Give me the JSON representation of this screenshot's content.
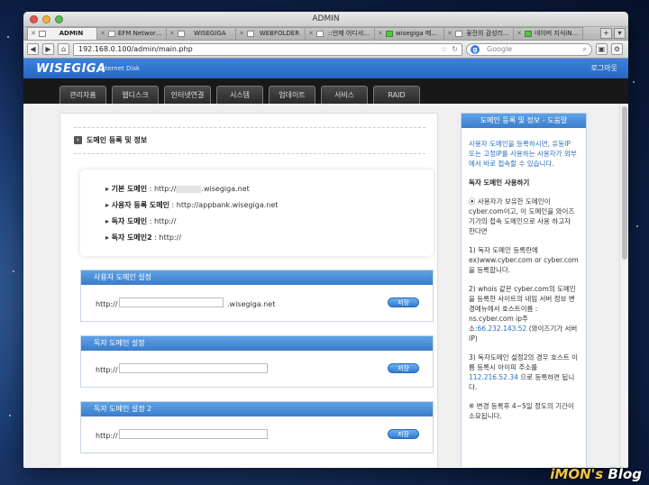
{
  "window": {
    "title": "ADMIN"
  },
  "tabs": [
    {
      "label": "ADMIN",
      "active": true,
      "favicon": "blank"
    },
    {
      "label": "EFM Networks...",
      "favicon": "blank"
    },
    {
      "label": "WISEGIGA",
      "favicon": "blank"
    },
    {
      "label": "WEBFOLDER",
      "favicon": "blank"
    },
    {
      "label": "::언제 어디서...",
      "favicon": "blank"
    },
    {
      "label": "wisegiga 메일 ...",
      "favicon": "green"
    },
    {
      "label": "꽃잔의 감성리...",
      "favicon": "blank"
    },
    {
      "label": "네이버 지식iN :...",
      "favicon": "green"
    }
  ],
  "toolbar": {
    "url": "192.168.0.100/admin/main.php",
    "search_placeholder": "Google"
  },
  "header": {
    "logo": "WISEGIGA",
    "logo_sub": "Internet Disk",
    "logout": "로그아웃"
  },
  "nav": [
    "관리자홈",
    "웹디스크",
    "인터넷연결",
    "시스템",
    "업데이트",
    "서비스",
    "RAID"
  ],
  "main": {
    "section_title": "도메인 등록 및 정보",
    "info": [
      {
        "label": "기본 도메인",
        "value_pre": "http://",
        "value_post": ".wisegiga.net",
        "blurred": true
      },
      {
        "label": "사용자 등록 도메인",
        "value_pre": "http://appbank.wisegiga.net"
      },
      {
        "label": "독자 도메인",
        "value_pre": "http://"
      },
      {
        "label": "독자 도메인2",
        "value_pre": "http://"
      }
    ],
    "boxes": [
      {
        "title": "사용자 도메인 설정",
        "prefix": "http://",
        "suffix": ".wisegiga.net",
        "save": "저장"
      },
      {
        "title": "독자 도메인 설정",
        "prefix": "http://",
        "suffix": "",
        "save": "저장"
      },
      {
        "title": "독자 도메인 설정 2",
        "prefix": "http://",
        "suffix": "",
        "save": "저장"
      }
    ]
  },
  "sidebar": {
    "title": "도메인 등록 및 정보 - 도움말",
    "intro": "사용자 도메인을 등록하시면, 유동IP 또는 고정IP를 사용하는 사용자가 외부에서 바로 접속할 수 있습니다.",
    "heading": "독자 도메인 사용하기",
    "p1": "⦿ 사용자가 보유한 도메인이 cyber.com이고, 이 도메인을 와이즈기가의 접속 도메인으로 사용 하고자 한다면",
    "p2": "1) 독자 도메인 등록란에 ex)www.cyber.com or cyber.com 을 등록합니다.",
    "p3a": "2) whois 같은 cyber.com의 도메인을 등록한 사이트의 네임 서버 정보 변경메뉴에서 호스트이름 : ns.cyber.com ip주소:",
    "p3ip": "66.232.143.52",
    "p3b": "(와이즈기가 서버IP)",
    "p4a": "3) 독자도메인 설정2의 경우 호스트 이름 등록시 아이피 주소를",
    "p4ip": "112.216.52.34",
    "p4b": "으로 등록하면 됩니다.",
    "p5": "※ 변경 등록후 4~5일 정도의 기간이 소요됩니다."
  },
  "watermark": {
    "a": "iMON's",
    "b": " Blog"
  }
}
